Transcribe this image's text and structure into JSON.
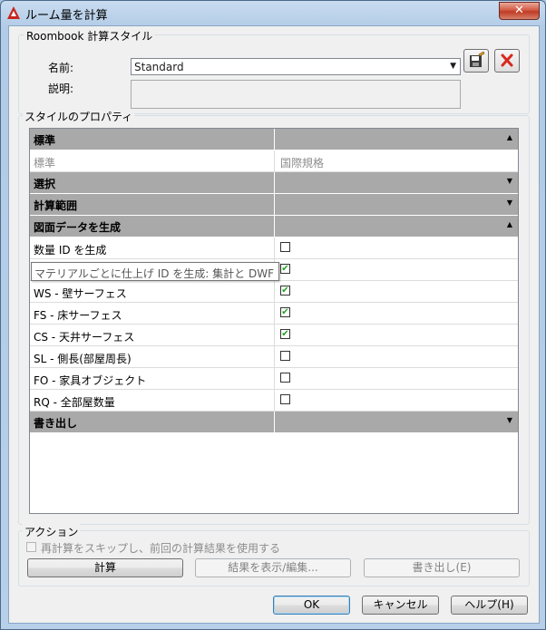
{
  "window": {
    "title": "ルーム量を計算",
    "close_glyph": "✕"
  },
  "style_group": {
    "title": "Roombook 計算スタイル",
    "name_label": "名前:",
    "name_value": "Standard",
    "description_label": "説明:",
    "description_value": ""
  },
  "properties": {
    "title": "スタイルのプロパティ",
    "rows": [
      {
        "type": "category",
        "label": "標準",
        "arrow": "▲"
      },
      {
        "type": "text",
        "label": "標準",
        "value": "国際規格"
      },
      {
        "type": "category",
        "label": "選択",
        "arrow": "▼"
      },
      {
        "type": "category",
        "label": "計算範囲",
        "arrow": "▼"
      },
      {
        "type": "category",
        "label": "図面データを生成",
        "arrow": "▲"
      },
      {
        "type": "checkbox",
        "label": "数量 ID を生成",
        "checked": false
      },
      {
        "type": "checkbox",
        "label": "",
        "checked": true
      },
      {
        "type": "checkbox",
        "label": "WS - 壁サーフェス",
        "checked": true
      },
      {
        "type": "checkbox",
        "label": "FS - 床サーフェス",
        "checked": true
      },
      {
        "type": "checkbox",
        "label": "CS - 天井サーフェス",
        "checked": true
      },
      {
        "type": "checkbox",
        "label": "SL - 側長(部屋周長)",
        "checked": false
      },
      {
        "type": "checkbox",
        "label": "FO - 家具オブジェクト",
        "checked": false
      },
      {
        "type": "checkbox",
        "label": "RQ - 全部屋数量",
        "checked": false
      },
      {
        "type": "category",
        "label": "書き出し",
        "arrow": "▼"
      }
    ],
    "tooltip": "マテリアルごとに仕上げ ID を生成: 集計と DWF"
  },
  "actions": {
    "title": "アクション",
    "skip_checkbox_label": "再計算をスキップし、前回の計算結果を使用する",
    "calculate_label": "計算",
    "show_edit_label": "結果を表示/編集...",
    "export_label": "書き出し(E)"
  },
  "footer": {
    "ok_label": "OK",
    "cancel_label": "キャンセル",
    "help_label": "ヘルプ(H)"
  },
  "icons": {
    "app": "autocad-a-icon",
    "save": "save-style-icon",
    "delete": "delete-red-x-icon",
    "check_mark": "✔"
  },
  "colors": {
    "category_bg": "#a9a9a9",
    "checkmark": "#21a121",
    "delete_red": "#d9281e",
    "title_bar": "#c9dcf0"
  }
}
